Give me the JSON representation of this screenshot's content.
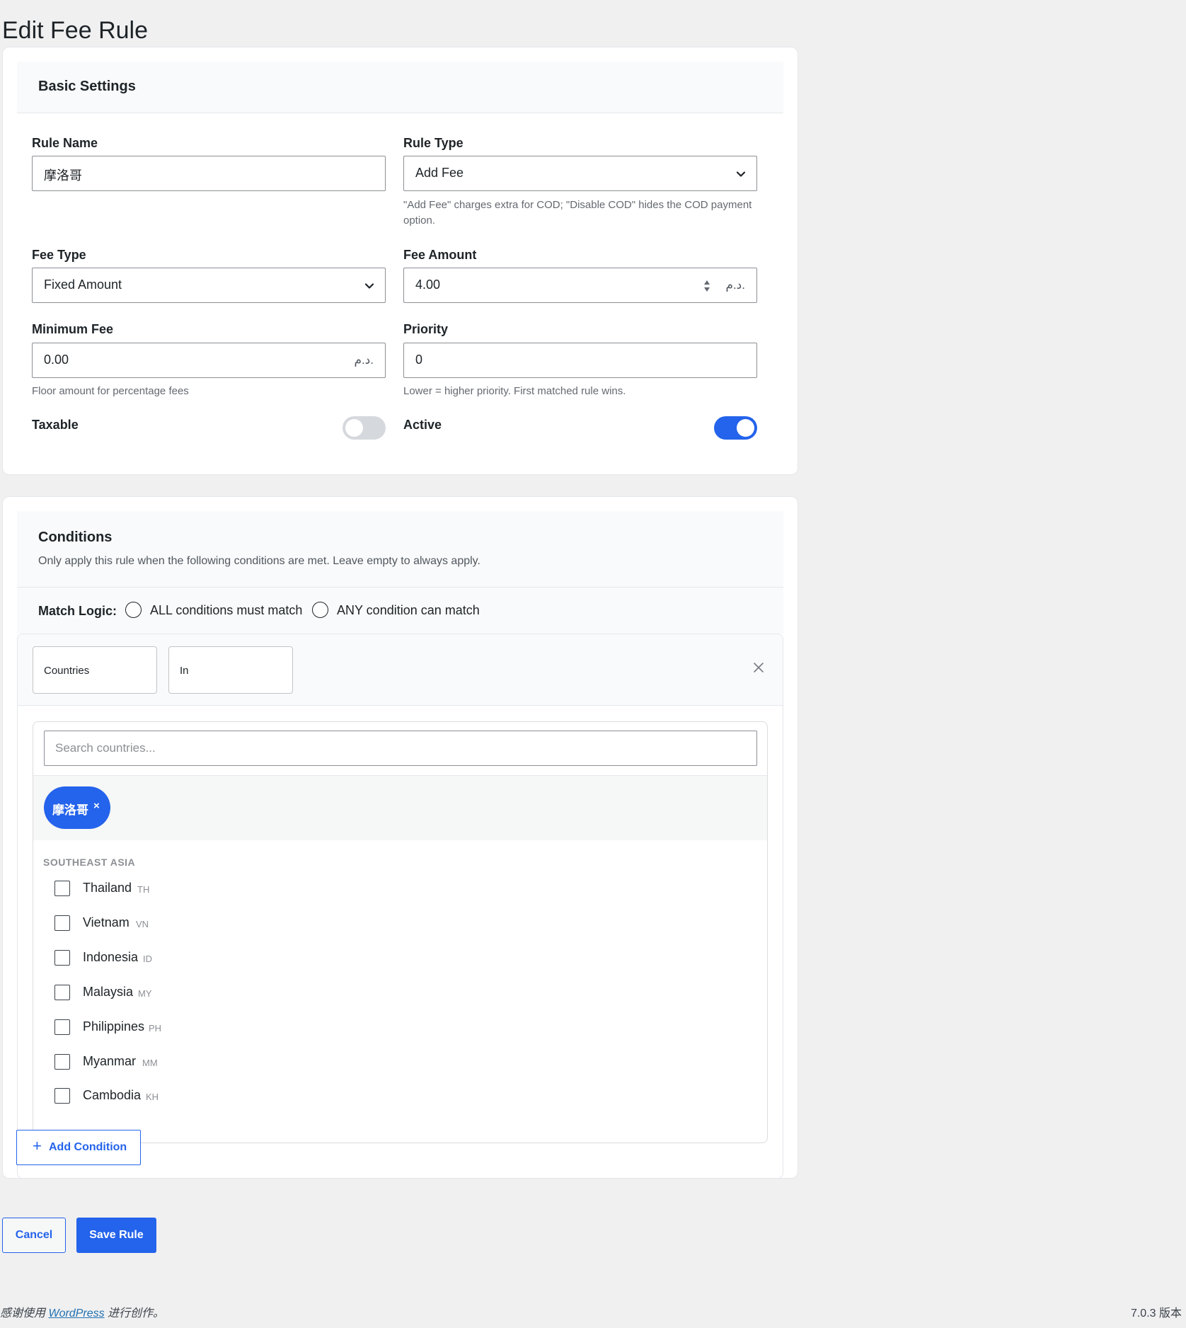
{
  "page": {
    "title": "Edit Fee Rule"
  },
  "basic": {
    "title": "Basic Settings",
    "rule_name": {
      "label": "Rule Name",
      "value": "摩洛哥"
    },
    "rule_type": {
      "label": "Rule Type",
      "value": "Add Fee",
      "help": "\"Add Fee\" charges extra for COD; \"Disable COD\" hides the COD payment option."
    },
    "fee_type": {
      "label": "Fee Type",
      "value": "Fixed Amount"
    },
    "fee_amount": {
      "label": "Fee Amount",
      "value": "4.00",
      "currency": "د.م."
    },
    "minimum_fee": {
      "label": "Minimum Fee",
      "value": "0.00",
      "currency": "د.م.",
      "help": "Floor amount for percentage fees"
    },
    "priority": {
      "label": "Priority",
      "value": "0",
      "help": "Lower = higher priority. First matched rule wins."
    },
    "taxable": {
      "label": "Taxable",
      "on": false
    },
    "active": {
      "label": "Active",
      "on": true
    }
  },
  "conditions": {
    "title": "Conditions",
    "subtitle": "Only apply this rule when the following conditions are met. Leave empty to always apply.",
    "match_logic": {
      "label": "Match Logic:",
      "options": [
        "ALL conditions must match",
        "ANY condition can match"
      ]
    },
    "row": {
      "field": "Countries",
      "operator": "In",
      "search_placeholder": "Search countries...",
      "selected": [
        {
          "label": "摩洛哥",
          "remove": "×"
        }
      ],
      "group": "SOUTHEAST ASIA",
      "countries": [
        {
          "name": "Thailand",
          "code": "TH"
        },
        {
          "name": "Vietnam",
          "code": "VN"
        },
        {
          "name": "Indonesia",
          "code": "ID"
        },
        {
          "name": "Malaysia",
          "code": "MY"
        },
        {
          "name": "Philippines",
          "code": "PH"
        },
        {
          "name": "Myanmar",
          "code": "MM"
        },
        {
          "name": "Cambodia",
          "code": "KH"
        }
      ]
    },
    "add_button": {
      "icon": "+",
      "label": "Add Condition"
    }
  },
  "actions": {
    "cancel": "Cancel",
    "save": "Save Rule"
  },
  "footer": {
    "prefix": "感谢使用",
    "link": "WordPress",
    "suffix": "进行创作。",
    "version": "7.0.3 版本"
  },
  "colors": {
    "accent": "#2463eb",
    "toggle_off": "#d5d8dc"
  }
}
